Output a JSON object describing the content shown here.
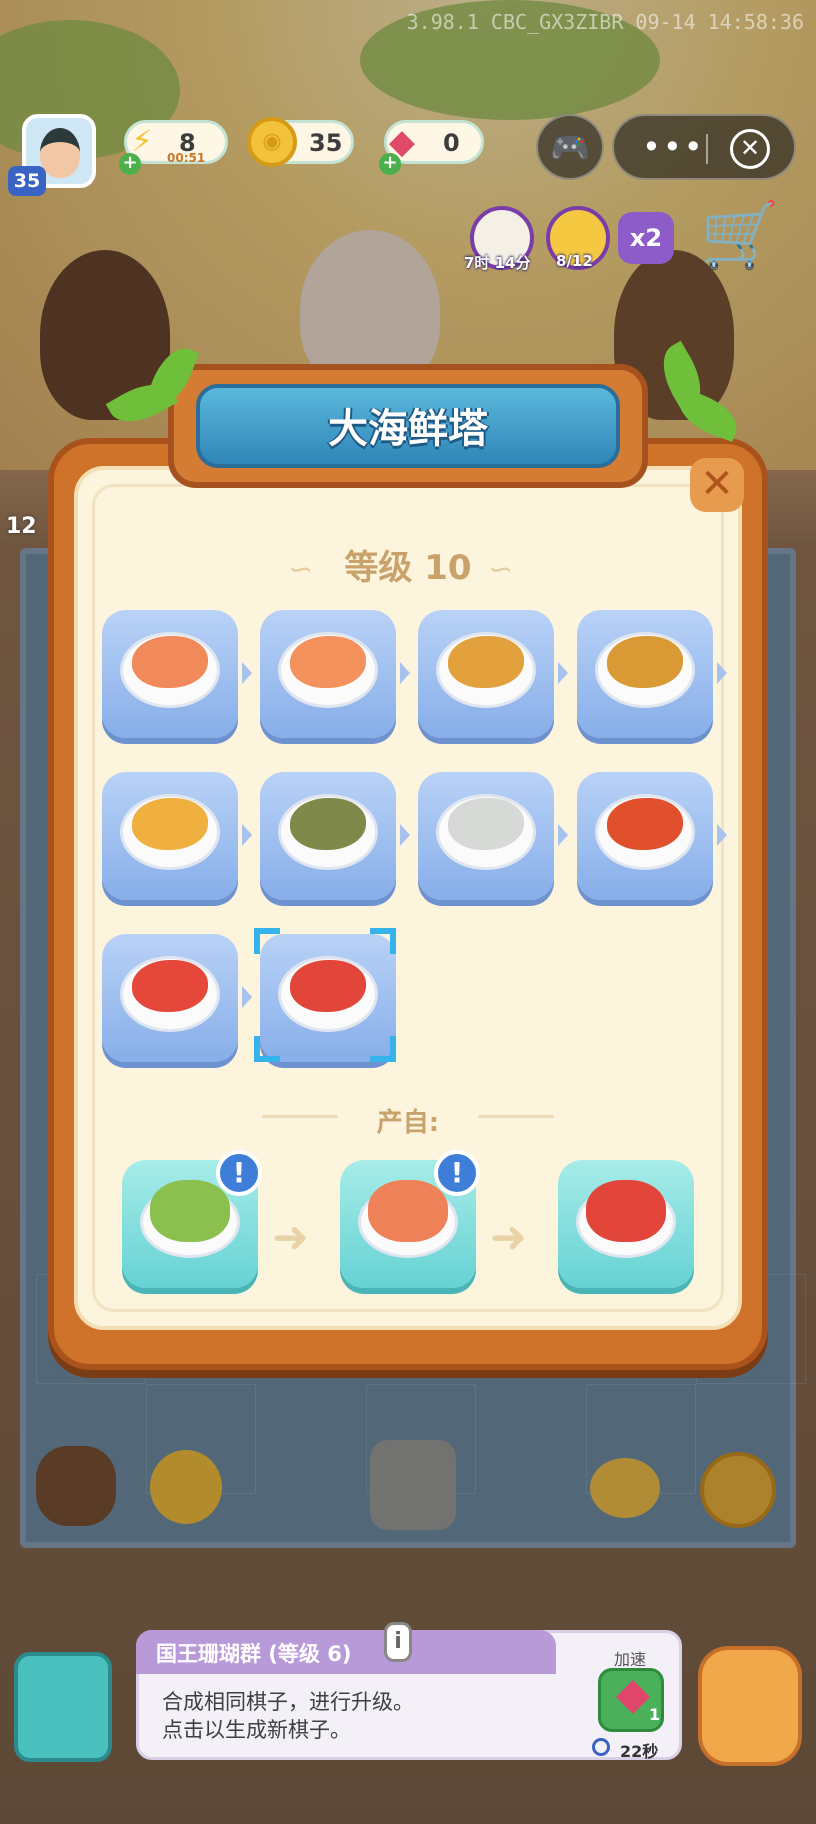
{
  "watermark": "3.98.1 CBC_GX3ZIBR 09-14 14:58:36",
  "hud": {
    "player_level": "35",
    "energy": "8",
    "energy_timer": "00:51",
    "coins": "35",
    "gems": "0",
    "event_timer_label": "7时 14分",
    "event_progress_label": "8/12",
    "multiplier_label": "x2"
  },
  "side_counter": "12",
  "modal": {
    "title": "大海鲜塔",
    "level_label": "等级 10",
    "chain_items": [
      {
        "name": "salmon-steak",
        "color": "#f08a5a"
      },
      {
        "name": "salmon-fillet-board",
        "color": "#f3925d"
      },
      {
        "name": "grilled-fish-plate",
        "color": "#e2a13c"
      },
      {
        "name": "fish-salad-plate",
        "color": "#d99a35"
      },
      {
        "name": "shrimp-pasta-plate",
        "color": "#f0b040"
      },
      {
        "name": "mussel-plate",
        "color": "#7f8a4a"
      },
      {
        "name": "oyster-plate",
        "color": "#d6d9d6"
      },
      {
        "name": "crab-plate",
        "color": "#e0502c"
      },
      {
        "name": "lobster-tail-plate",
        "color": "#e5473a"
      },
      {
        "name": "seafood-tower",
        "color": "#e2463a"
      }
    ],
    "produced_by_label": "产自:",
    "produced_chain": [
      {
        "name": "green-tent",
        "color": "#8cc04e",
        "alert": "!"
      },
      {
        "name": "seafood-platter",
        "color": "#f0825a",
        "alert": "!"
      },
      {
        "name": "seafood-tower",
        "color": "#e2463a",
        "alert": ""
      }
    ]
  },
  "bottom": {
    "item_title": "国王珊瑚群 (等级 6)",
    "hint_line1": "合成相同棋子，进行升级。",
    "hint_line2": "点击以生成新棋子。",
    "speedup_label": "加速",
    "speedup_cost": "1",
    "speedup_time": "22秒"
  }
}
